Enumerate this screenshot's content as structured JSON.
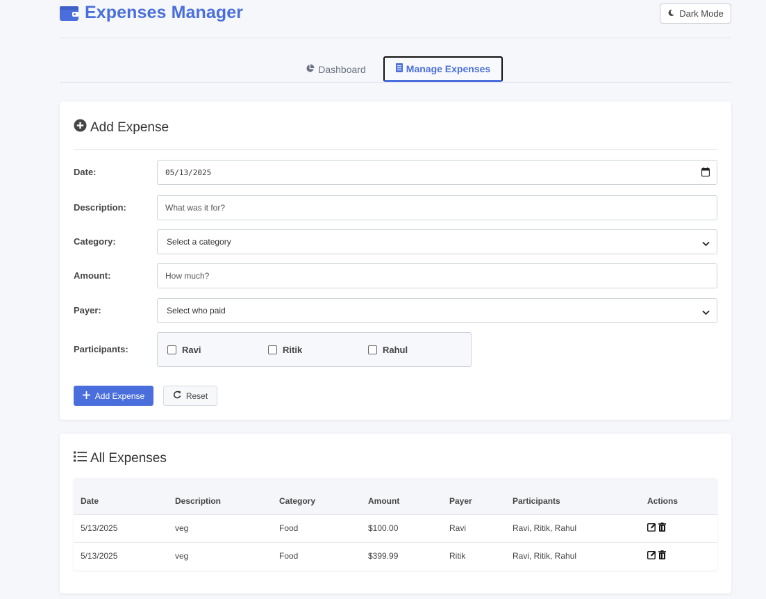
{
  "header": {
    "title": "Expenses Manager",
    "dark_mode_label": "Dark Mode"
  },
  "tabs": {
    "dashboard": "Dashboard",
    "manage": "Manage Expenses"
  },
  "add_form": {
    "title": "Add Expense",
    "date_label": "Date:",
    "date_value": "05/13/2025",
    "description_label": "Description:",
    "description_placeholder": "What was it for?",
    "category_label": "Category:",
    "category_value": "Select a category",
    "amount_label": "Amount:",
    "amount_placeholder": "How much?",
    "payer_label": "Payer:",
    "payer_value": "Select who paid",
    "participants_label": "Participants:",
    "participants": [
      "Ravi",
      "Ritik",
      "Rahul"
    ],
    "add_button": "Add Expense",
    "reset_button": "Reset"
  },
  "expenses": {
    "title": "All Expenses",
    "columns": [
      "Date",
      "Description",
      "Category",
      "Amount",
      "Payer",
      "Participants",
      "Actions"
    ],
    "rows": [
      {
        "date": "5/13/2025",
        "description": "veg",
        "category": "Food",
        "amount": "$100.00",
        "payer": "Ravi",
        "participants": "Ravi, Ritik, Rahul"
      },
      {
        "date": "5/13/2025",
        "description": "veg",
        "category": "Food",
        "amount": "$399.99",
        "payer": "Ritik",
        "participants": "Ravi, Ritik, Rahul"
      }
    ]
  },
  "colors": {
    "accent": "#4a6fdc",
    "background": "#f5f7fb"
  },
  "icons": [
    "wallet-icon",
    "moon-icon",
    "pie-chart-icon",
    "receipt-icon",
    "plus-circle-icon",
    "calendar-icon",
    "chevron-down-icon",
    "list-icon",
    "plus-icon",
    "refresh-icon",
    "edit-icon",
    "trash-icon"
  ]
}
